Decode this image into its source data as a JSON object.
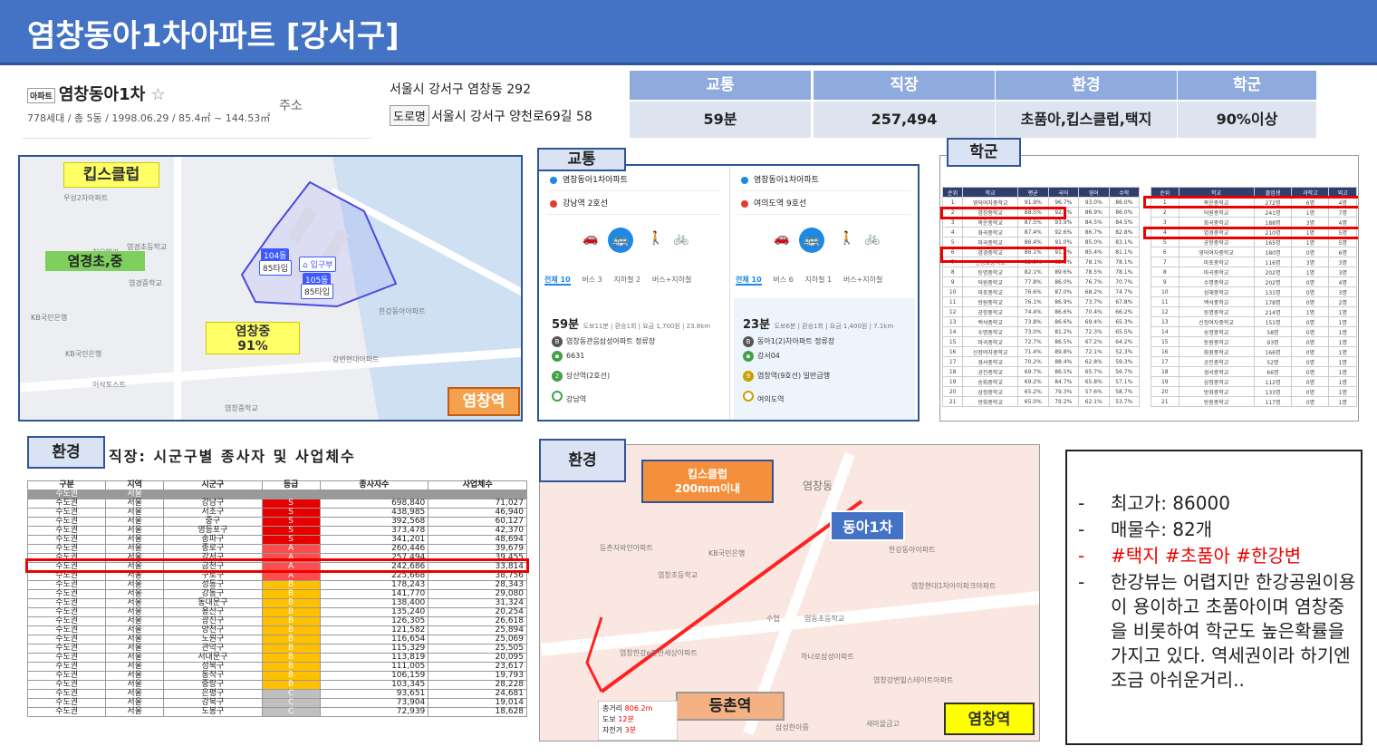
{
  "title": "염창동아1차아파트 [강서구]",
  "info": {
    "tag": "아파트",
    "name": "염창동아1차",
    "star": "☆",
    "specs": "778세대 / 총 5동 / 1998.06.29 / 85.4㎡ ~ 144.53㎡",
    "address_label": "주소",
    "address": "서울시 강서구 염창동 292",
    "road_tag": "도로명",
    "road_address": "서울시 강서구 양천로69길 58"
  },
  "summary": {
    "headers": [
      "교통",
      "직장",
      "환경",
      "학군"
    ],
    "values": [
      "59분",
      "257,494",
      "초품아,킵스클럽,택지",
      "90%이상"
    ]
  },
  "map1": {
    "kids_club": "킵스클럽",
    "elem_school": "염경초,중",
    "middle_school": "염창중",
    "middle_pct": "91%",
    "station": "염창역",
    "dong104": "104동",
    "type104": "85타입",
    "entrance": "입구부",
    "dong105": "105동",
    "type105": "85타입",
    "labels": [
      "염경중학교",
      "염경초등학교",
      "KB국민은행",
      "이삭토스트",
      "한강동아아파트",
      "치오빌라",
      "강변현대아파트",
      "염창중학교",
      "우성2차아파트",
      "염경중학교"
    ]
  },
  "transport": {
    "label": "교통",
    "left": {
      "from": "염창동아1차아파트",
      "to": "강남역 2호선",
      "tabs": [
        "전체 10",
        "버스 3",
        "지하철 2",
        "버스+지하철"
      ],
      "time": "59분",
      "detail": "도보11분 | 환승1회 | 요금 1,700원 | 23.8km",
      "steps": [
        "염창동관음삼성아파트 정류장",
        "6631",
        "당산역(2호선)",
        "강남역"
      ]
    },
    "right": {
      "from": "염창동아1차아파트",
      "to": "여의도역 9호선",
      "tabs": [
        "전체 10",
        "버스 6",
        "지하철 1",
        "버스+지하철"
      ],
      "time": "23분",
      "detail": "도보6분 | 환승1회 | 요금 1,400원 | 7.1km",
      "steps": [
        "동아1(2)차아파트 정류장",
        "강서04",
        "염창역(9호선) 일반급행",
        "여의도역"
      ]
    }
  },
  "school": {
    "label": "학군",
    "left_headers": [
      "순위",
      "학교",
      "평균",
      "국어",
      "영어",
      "수학"
    ],
    "left_rows": [
      [
        "1",
        "영덕여자중학교",
        "91.9%",
        "96.7%",
        "93.0%",
        "86.0%"
      ],
      [
        "2",
        "염창중학교",
        "88.5%",
        "92.6%",
        "86.9%",
        "86.0%"
      ],
      [
        "3",
        "목운중학교",
        "87.5%",
        "93.9%",
        "84.5%",
        "84.5%"
      ],
      [
        "4",
        "화곡중학교",
        "87.4%",
        "92.6%",
        "86.7%",
        "82.8%"
      ],
      [
        "5",
        "마곡중학교",
        "86.4%",
        "91.0%",
        "85.0%",
        "83.1%"
      ],
      [
        "6",
        "염경중학교",
        "86.1%",
        "91.7%",
        "85.4%",
        "81.1%"
      ],
      [
        "7",
        "신방화중학교",
        "82.8%",
        "92.1%",
        "78.1%",
        "78.1%"
      ],
      [
        "8",
        "등명중학교",
        "82.1%",
        "89.6%",
        "78.5%",
        "78.1%"
      ],
      [
        "9",
        "덕원중학교",
        "77.8%",
        "86.0%",
        "76.7%",
        "70.7%"
      ],
      [
        "10",
        "마포중학교",
        "76.6%",
        "87.0%",
        "68.2%",
        "74.7%"
      ],
      [
        "11",
        "방원중학교",
        "76.1%",
        "86.9%",
        "73.7%",
        "67.8%"
      ],
      [
        "12",
        "공항중학교",
        "74.4%",
        "86.6%",
        "70.4%",
        "66.2%"
      ],
      [
        "13",
        "백석중학교",
        "73.8%",
        "86.6%",
        "69.4%",
        "65.3%"
      ],
      [
        "14",
        "수명중학교",
        "73.0%",
        "81.2%",
        "72.3%",
        "65.5%"
      ],
      [
        "15",
        "마곡중학교",
        "72.7%",
        "86.5%",
        "67.2%",
        "64.2%"
      ],
      [
        "16",
        "신정여자중학교",
        "71.4%",
        "89.8%",
        "72.1%",
        "52.3%"
      ],
      [
        "17",
        "경서중학교",
        "70.2%",
        "88.4%",
        "62.8%",
        "59.3%"
      ],
      [
        "18",
        "공진중학교",
        "69.7%",
        "86.5%",
        "65.7%",
        "56.7%"
      ],
      [
        "19",
        "송화중학교",
        "69.2%",
        "84.7%",
        "65.8%",
        "57.1%"
      ],
      [
        "20",
        "삼정중학교",
        "65.2%",
        "79.3%",
        "57.6%",
        "58.7%"
      ],
      [
        "21",
        "방화중학교",
        "65.0%",
        "79.2%",
        "62.1%",
        "53.7%"
      ]
    ],
    "right_headers": [
      "순위",
      "학교",
      "졸업생",
      "과학고",
      "외고"
    ],
    "right_rows": [
      [
        "1",
        "목운중학교",
        "272명",
        "6명",
        "4명"
      ],
      [
        "2",
        "덕원중학교",
        "241명",
        "1명",
        "7명"
      ],
      [
        "3",
        "화곡중학교",
        "188명",
        "3명",
        "4명"
      ],
      [
        "4",
        "염경중학교",
        "210명",
        "1명",
        "5명"
      ],
      [
        "5",
        "공항중학교",
        "165명",
        "1명",
        "5명"
      ],
      [
        "6",
        "영덕여자중학교",
        "180명",
        "0명",
        "6명"
      ],
      [
        "7",
        "마포중학교",
        "116명",
        "3명",
        "3명"
      ],
      [
        "8",
        "마곡중학교",
        "202명",
        "1명",
        "3명"
      ],
      [
        "9",
        "수명중학교",
        "202명",
        "0명",
        "4명"
      ],
      [
        "10",
        "성재중학교",
        "131명",
        "0명",
        "3명"
      ],
      [
        "11",
        "백석중학교",
        "178명",
        "0명",
        "2명"
      ],
      [
        "12",
        "등명중학교",
        "214명",
        "1명",
        "1명"
      ],
      [
        "13",
        "신정여자중학교",
        "151명",
        "0명",
        "1명"
      ],
      [
        "14",
        "송정중학교",
        "58명",
        "0명",
        "1명"
      ],
      [
        "15",
        "등원중학교",
        "93명",
        "0명",
        "1명"
      ],
      [
        "16",
        "화원중학교",
        "166명",
        "0명",
        "1명"
      ],
      [
        "17",
        "공진중학교",
        "52명",
        "0명",
        "1명"
      ],
      [
        "18",
        "경서중학교",
        "66명",
        "0명",
        "1명"
      ],
      [
        "19",
        "삼정중학교",
        "112명",
        "0명",
        "1명"
      ],
      [
        "20",
        "방화중학교",
        "133명",
        "0명",
        "1명"
      ],
      [
        "21",
        "방원중학교",
        "117명",
        "0명",
        "1명"
      ]
    ]
  },
  "jobs": {
    "label": "환경",
    "title": "직장: 시군구별 종사자 및 사업체수",
    "headers": [
      "구분",
      "지역",
      "시군구",
      "등급",
      "종사자수",
      "사업체수"
    ],
    "subheader": [
      "수도권",
      "서울"
    ],
    "rows": [
      [
        "수도권",
        "서울",
        "강남구",
        "S",
        "698,840",
        "71,027",
        "s"
      ],
      [
        "수도권",
        "서울",
        "서초구",
        "S",
        "438,985",
        "46,940",
        "s"
      ],
      [
        "수도권",
        "서울",
        "중구",
        "S",
        "392,568",
        "60,127",
        "s"
      ],
      [
        "수도권",
        "서울",
        "영등포구",
        "S",
        "373,478",
        "42,370",
        "s"
      ],
      [
        "수도권",
        "서울",
        "송파구",
        "S",
        "341,201",
        "48,694",
        "s"
      ],
      [
        "수도권",
        "서울",
        "종로구",
        "A",
        "260,446",
        "39,679",
        "a"
      ],
      [
        "수도권",
        "서울",
        "강서구",
        "A",
        "257,494",
        "39,455",
        "a"
      ],
      [
        "수도권",
        "서울",
        "금천구",
        "A",
        "242,686",
        "33,814",
        "a"
      ],
      [
        "수도권",
        "서울",
        "구로구",
        "A",
        "225,668",
        "38,756",
        "a"
      ],
      [
        "수도권",
        "서울",
        "성동구",
        "B",
        "178,243",
        "28,343",
        "b"
      ],
      [
        "수도권",
        "서울",
        "강동구",
        "B",
        "141,770",
        "29,080",
        "b"
      ],
      [
        "수도권",
        "서울",
        "동대문구",
        "B",
        "138,400",
        "31,324",
        "b"
      ],
      [
        "수도권",
        "서울",
        "용산구",
        "B",
        "135,240",
        "20,254",
        "b"
      ],
      [
        "수도권",
        "서울",
        "광진구",
        "B",
        "126,305",
        "26,618",
        "b"
      ],
      [
        "수도권",
        "서울",
        "양천구",
        "B",
        "121,582",
        "25,894",
        "b"
      ],
      [
        "수도권",
        "서울",
        "노원구",
        "B",
        "116,654",
        "25,069",
        "b"
      ],
      [
        "수도권",
        "서울",
        "관악구",
        "B",
        "115,329",
        "25,505",
        "b"
      ],
      [
        "수도권",
        "서울",
        "서대문구",
        "B",
        "113,819",
        "20,095",
        "b"
      ],
      [
        "수도권",
        "서울",
        "성북구",
        "B",
        "111,005",
        "23,617",
        "b"
      ],
      [
        "수도권",
        "서울",
        "동작구",
        "B",
        "106,159",
        "19,793",
        "b"
      ],
      [
        "수도권",
        "서울",
        "중랑구",
        "B",
        "103,345",
        "28,228",
        "b"
      ],
      [
        "수도권",
        "서울",
        "은평구",
        "C",
        "93,651",
        "24,681",
        "c"
      ],
      [
        "수도권",
        "서울",
        "강북구",
        "C",
        "73,904",
        "19,014",
        "c"
      ],
      [
        "수도권",
        "서울",
        "도봉구",
        "C",
        "72,939",
        "18,628",
        "c"
      ]
    ]
  },
  "map2": {
    "label": "환경",
    "kids_club": "킵스클럽\n200mm이내",
    "apt": "동아1차",
    "station1": "등촌역",
    "station2": "염창역",
    "dist_label": "총거리",
    "dist": "806.2m",
    "walk_label": "도보",
    "walk": "12분",
    "bike_label": "자전거",
    "bike": "3분",
    "labels": [
      "염창동",
      "한강동아아파트",
      "KB국민은행",
      "염창초등학교",
      "등촌지와인아파트",
      "염동초등학교",
      "수협",
      "염창한강e편한세상아파트",
      "하나로삼성아파트",
      "염창강변힐스테이트아파트",
      "염창현대1차아이파크아파트",
      "새마을금고",
      "삼성한아름"
    ]
  },
  "notes": {
    "items": [
      {
        "text": "최고가: 86000",
        "red": false
      },
      {
        "text": "매물수: 82개",
        "red": false
      },
      {
        "text": "#택지 #초품아 #한강변",
        "red": true
      },
      {
        "text": "한강뷰는 어렵지만 한강공원이용이 용이하고 초품아이며 염창중을 비롯하여 학군도 높은확률을 가지고 있다. 역세권이라 하기엔 조금 아쉬운거리..",
        "red": false
      }
    ]
  }
}
